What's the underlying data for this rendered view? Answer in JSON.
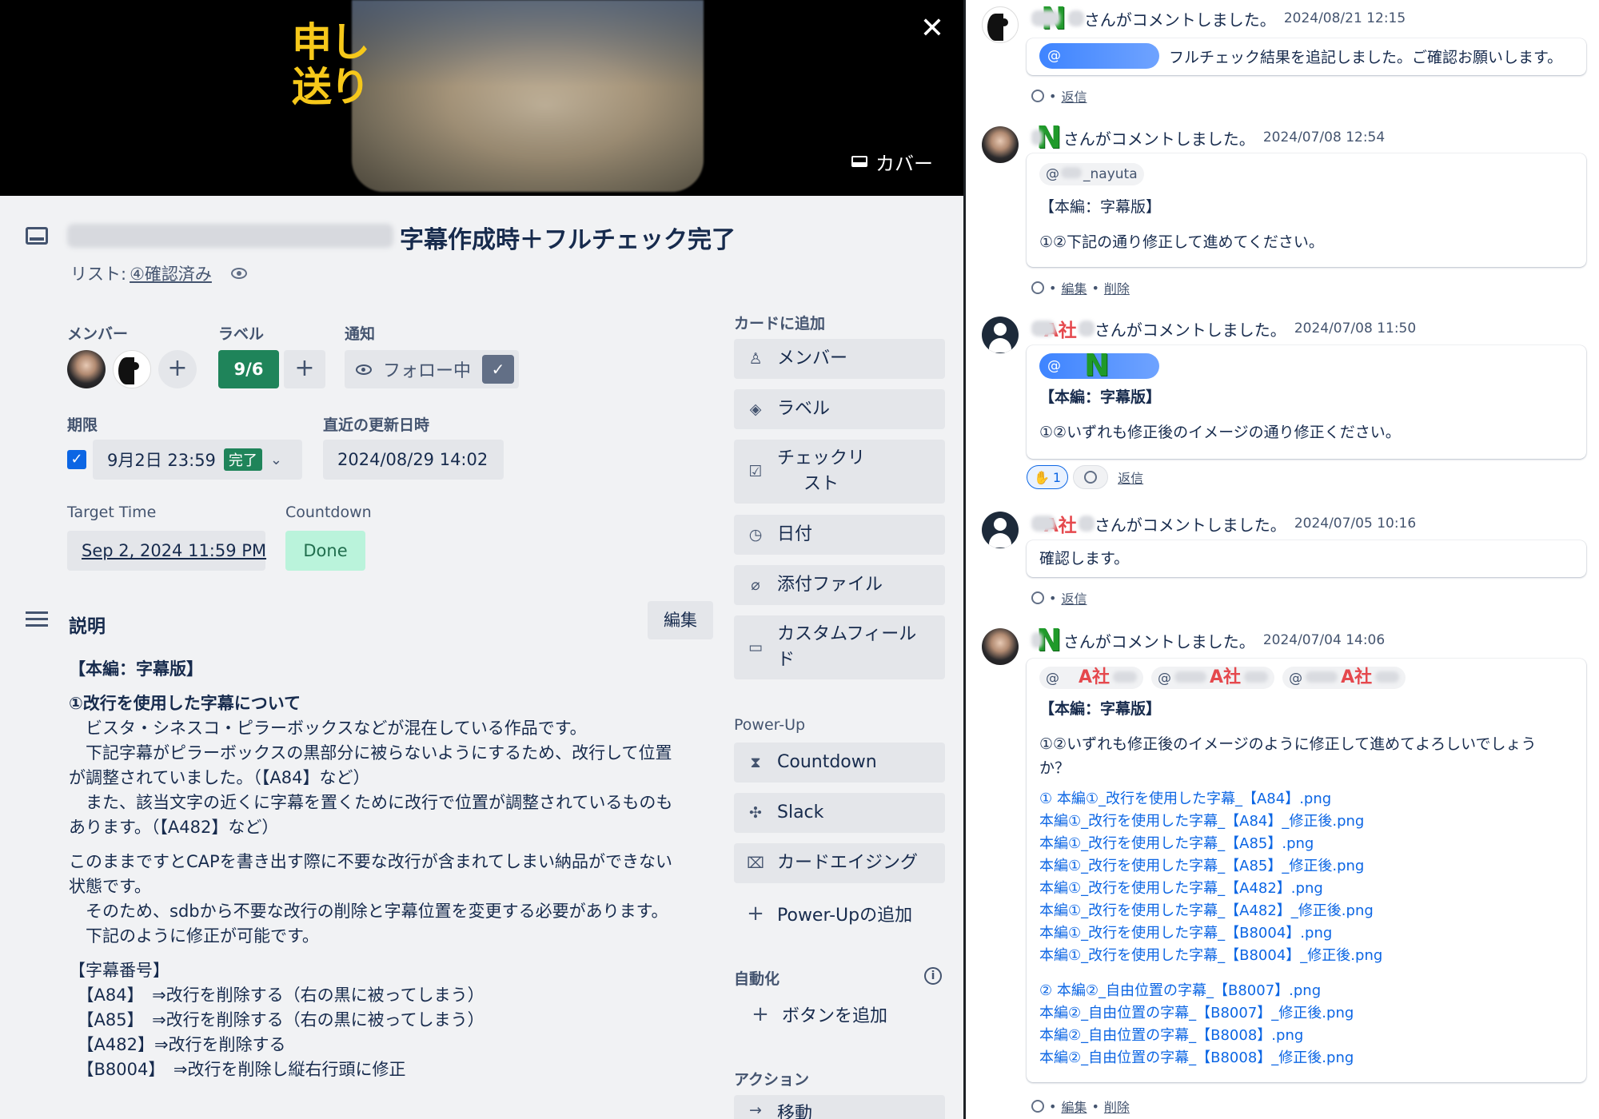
{
  "cover": {
    "stamp": "申し\n送り",
    "close": "✕",
    "cover_button": "カバー"
  },
  "card": {
    "title": "字幕作成時＋フルチェック完了",
    "list_prefix": "リスト:",
    "list_name": "④確認済み"
  },
  "members": {
    "label": "メンバー",
    "add": "+"
  },
  "labels": {
    "label": "ラベル",
    "chip": "9/6",
    "add": "+"
  },
  "notify": {
    "label": "通知",
    "button": "フォロー中",
    "check": "✓"
  },
  "due": {
    "label": "期限",
    "value": "9月2日 23:59",
    "badge": "完了",
    "chevron": "⌄"
  },
  "updated": {
    "label": "直近の更新日時",
    "value": "2024/08/29 14:02"
  },
  "target_time": {
    "label": "Target Time",
    "value": "Sep 2, 2024 11:59 PM"
  },
  "countdown": {
    "label": "Countdown",
    "value": "Done"
  },
  "description": {
    "heading": "説明",
    "edit": "編集",
    "lines": [
      "【本編：字幕版】",
      "①改行を使用した字幕について",
      "　ビスタ・シネスコ・ピラーボックスなどが混在している作品です。",
      "　下記字幕がピラーボックスの黒部分に被らないようにするため、改行して位置",
      "が調整されていました。（【A84】など）",
      "　また、該当文字の近くに字幕を置くために改行で位置が調整されているものも",
      "あります。（【A482】など）",
      "このままですとCAPを書き出す際に不要な改行が含まれてしまい納品ができない",
      "状態です。",
      "　そのため、sdbから不要な改行の削除と字幕位置を変更する必要があります。",
      "　下記のように修正が可能です。",
      "【字幕番号】",
      "　【A84】　⇒改行を削除する（右の黒に被ってしまう）",
      "　【A85】　⇒改行を削除する（右の黒に被ってしまう）",
      "　【A482】⇒改行を削除する",
      "　【B8004】　⇒改行を削除し縦右行頭に修正"
    ]
  },
  "sidebar": {
    "add_to_card": "カードに追加",
    "member": "メンバー",
    "label": "ラベル",
    "checklist": "チェックリ\nスト",
    "date": "日付",
    "attachment": "添付ファイル",
    "custom_field": "カスタムフィール\nド",
    "powerup_label": "Power-Up",
    "countdown": "Countdown",
    "slack": "Slack",
    "card_aging": "カードエイジング",
    "add_powerup": "Power-Upの追加",
    "automation_label": "自動化",
    "add_button": "ボタンを追加",
    "actions_label": "アクション",
    "move": "移動"
  },
  "comments": [
    {
      "logo": "N",
      "suffix": "さんがコメントしました。",
      "time": "2024/08/21 12:15",
      "body": "フルチェック結果を追記しました。ご確認お願いします。",
      "mention": "@",
      "actions": "返信"
    },
    {
      "logo": "N",
      "suffix": "さんがコメントしました。",
      "time": "2024/07/08 12:54",
      "mention": "@",
      "mention_name": "_nayuta",
      "lines": [
        "【本編：字幕版】",
        "①②下記の通り修正して進めてください。"
      ],
      "edit": "編集",
      "delete": "削除"
    },
    {
      "logo": "A社",
      "suffix": "さんがコメントしました。",
      "time": "2024/07/08 11:50",
      "mention": "@",
      "mention_logo": "N",
      "lines": [
        "【本編：字幕版】",
        "①②いずれも修正後のイメージの通り修正ください。"
      ],
      "reaction_count": "1",
      "reply": "返信"
    },
    {
      "logo": "A社",
      "suffix": "さんがコメントしました。",
      "time": "2024/07/05 10:16",
      "body": "確認します。",
      "reply": "返信"
    },
    {
      "logo": "N",
      "suffix": "さんがコメントしました。",
      "time": "2024/07/04 14:06",
      "mentions": [
        "@",
        "@",
        "@"
      ],
      "mention_tag": "A社",
      "heading": "【本編：字幕版】",
      "question_1": "①②いずれも修正後のイメージのように修正して進めてよろしいでしょう",
      "question_2": "か？",
      "files_1": [
        "① 本編①_改行を使用した字幕_【A84】.png",
        "本編①_改行を使用した字幕_【A84】_修正後.png",
        "本編①_改行を使用した字幕_【A85】.png",
        "本編①_改行を使用した字幕_【A85】_修正後.png",
        "本編①_改行を使用した字幕_【A482】.png",
        "本編①_改行を使用した字幕_【A482】_修正後.png",
        "本編①_改行を使用した字幕_【B8004】.png",
        "本編①_改行を使用した字幕_【B8004】_修正後.png"
      ],
      "files_2": [
        "② 本編②_自由位置の字幕_【B8007】.png",
        "本編②_自由位置の字幕_【B8007】_修正後.png",
        "本編②_自由位置の字幕_【B8008】.png",
        "本編②_自由位置の字幕_【B8008】_修正後.png"
      ],
      "edit": "編集",
      "delete": "削除"
    }
  ],
  "colors": {
    "accent": "#0c66e4",
    "label_green": "#1f845a",
    "done_bg": "#baf3db",
    "stamp": "#f6c81a",
    "n_logo": "#1f9a2a",
    "a_logo": "#e5484d"
  }
}
